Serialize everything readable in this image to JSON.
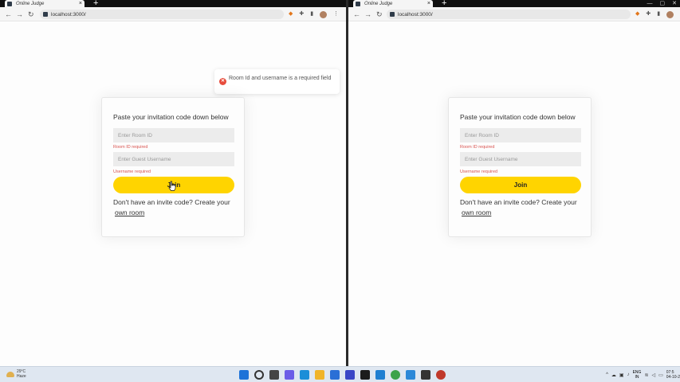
{
  "browser": {
    "tab_title": "Online Judge",
    "tab_close": "×",
    "new_tab": "+",
    "url": "localhost:3000/",
    "back": "←",
    "forward": "→",
    "reload": "↻",
    "menu": "⋮",
    "minimize": "—",
    "maximize": "▢",
    "close": "✕"
  },
  "toast": {
    "message": "Room Id and username is a required field",
    "icon": "✕"
  },
  "form": {
    "heading": "Paste your invitation code down below",
    "room_placeholder": "Enter Room ID",
    "room_error": "Room ID required",
    "username_placeholder": "Enter Guest Username",
    "username_error": "Username required",
    "join_label": "Join",
    "invite_text": "Don't have an invite code? Create your",
    "own_room_link": "own room"
  },
  "taskbar": {
    "temperature": "29°C",
    "condition": "Haze",
    "lang_line1": "ENG",
    "lang_line2": "IN",
    "time": "07:5",
    "date": "04-10-2"
  },
  "colors": {
    "accent": "#ffd400",
    "error": "#d9534f",
    "toast_icon": "#e74c3c"
  }
}
